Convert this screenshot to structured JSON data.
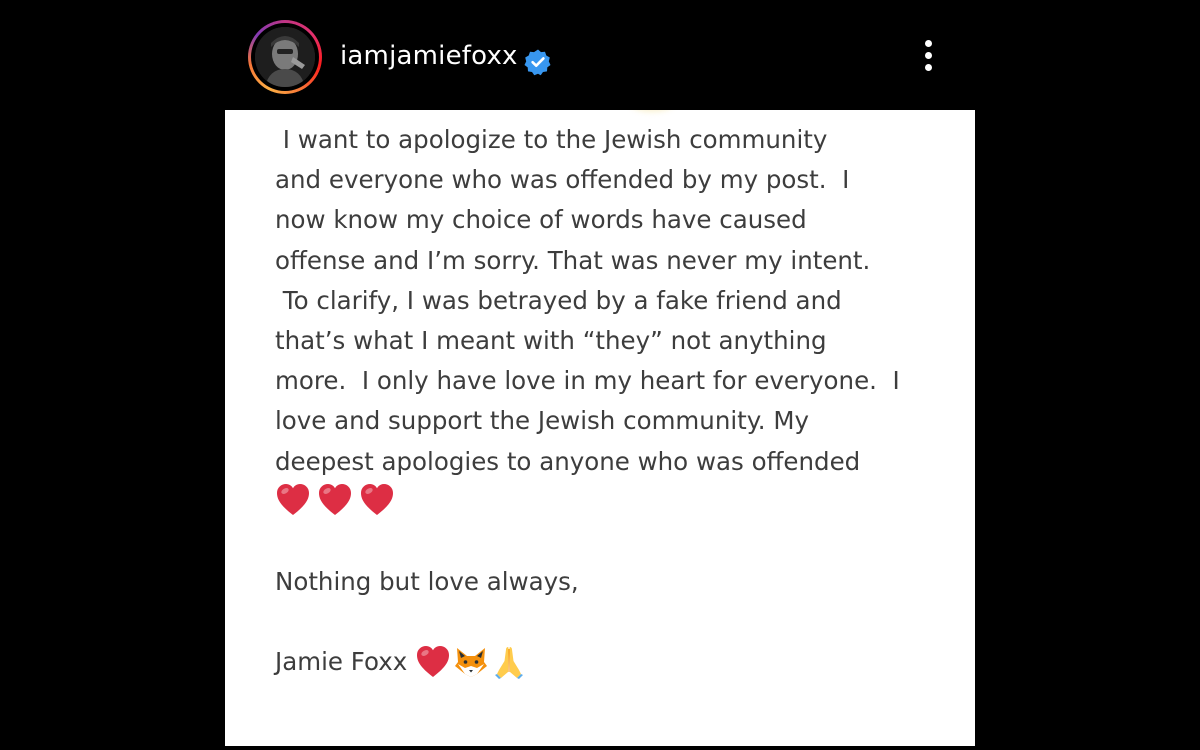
{
  "header": {
    "username": "iamjamiefoxx",
    "verified_color": "#3897f0",
    "avatar_icon": "profile-photo",
    "more_icon": "vertical-ellipsis-icon"
  },
  "post": {
    "statement_lines": [
      " I want to apologize to the Jewish community",
      "and everyone who was offended by my post.  I",
      "now know my choice of words have caused",
      "offense and I’m sorry. That was never my intent.",
      " To clarify, I was betrayed by a fake friend and",
      "that’s what I meant with “they” not anything",
      "more.  I only have love in my heart for everyone.  I",
      "love and support the Jewish community. My",
      "deepest apologies to anyone who was offended"
    ],
    "hearts": [
      "red-heart-emoji",
      "red-heart-emoji",
      "red-heart-emoji"
    ],
    "closing": "Nothing but love always,",
    "signature": "Jamie Foxx",
    "signature_emojis": [
      "red-heart-emoji",
      "fox-face-emoji",
      "folded-hands-emoji"
    ],
    "text_color": "#3d3d3d",
    "background_color": "#ffffff"
  },
  "theme": {
    "app_background": "#000000"
  }
}
